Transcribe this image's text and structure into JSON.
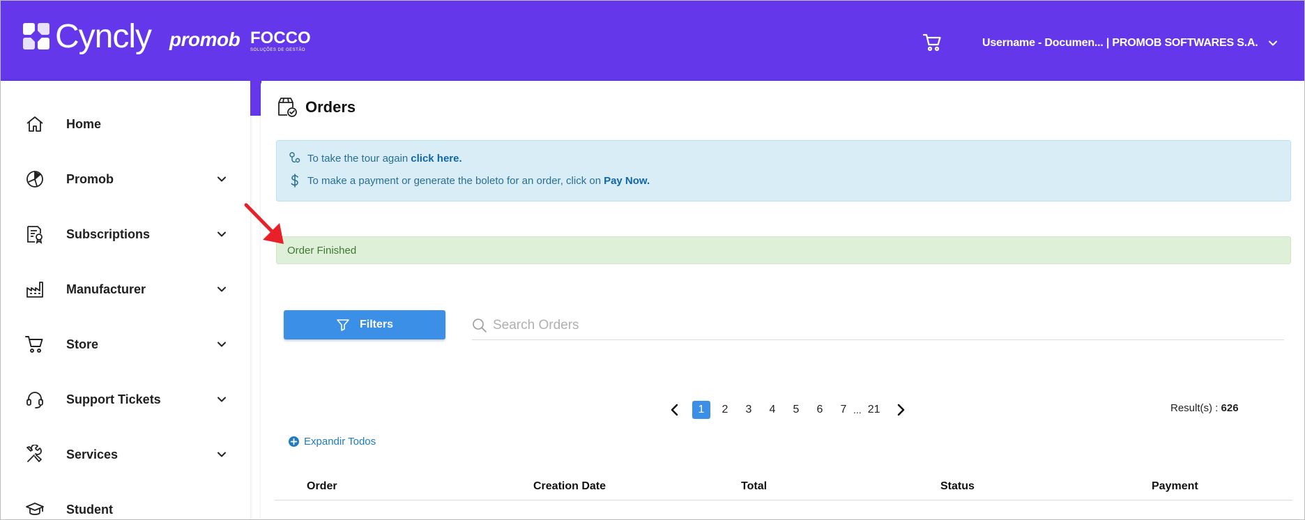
{
  "header": {
    "logo_cyncly": "Cyncly",
    "logo_promob": "promob",
    "logo_focco": "FOCCO",
    "logo_focco_tagline": "SOLUÇÕES DE GESTÃO",
    "user_label": "Username - Documen... | PROMOB SOFTWARES S.A.",
    "icons": {
      "cart": "cart-icon",
      "user_dropdown": "chevron-down-icon"
    }
  },
  "sidebar": {
    "items": [
      {
        "label": "Home",
        "icon": "home-icon",
        "has_submenu": false
      },
      {
        "label": "Promob",
        "icon": "promob-icon",
        "has_submenu": true
      },
      {
        "label": "Subscriptions",
        "icon": "subscriptions-icon",
        "has_submenu": true
      },
      {
        "label": "Manufacturer",
        "icon": "factory-icon",
        "has_submenu": true
      },
      {
        "label": "Store",
        "icon": "cart-icon",
        "has_submenu": true
      },
      {
        "label": "Support Tickets",
        "icon": "headset-icon",
        "has_submenu": true
      },
      {
        "label": "Services",
        "icon": "tools-icon",
        "has_submenu": true
      },
      {
        "label": "Student",
        "icon": "graduation-cap-icon",
        "has_submenu": false
      }
    ]
  },
  "main": {
    "title": "Orders",
    "info": {
      "tour_text": "To take the tour again",
      "tour_link": "click here.",
      "payment_text": "To make a payment or generate the boleto for an order, click on",
      "payment_link": "Pay Now."
    },
    "alert": "Order Finished",
    "filters_label": "Filters",
    "search_placeholder": "Search Orders",
    "pagination": {
      "pages": [
        "1",
        "2",
        "3",
        "4",
        "5",
        "6",
        "7"
      ],
      "ellipsis": "...",
      "last_page": "21",
      "current": "1"
    },
    "results_label": "Result(s) :",
    "results_count": "626",
    "expand_all": "Expandir Todos",
    "table_columns": [
      "Order",
      "Creation Date",
      "Total",
      "Status",
      "Payment"
    ]
  },
  "colors": {
    "brand_purple": "#6438ea",
    "primary_blue": "#3c8fe6",
    "info_bg": "#d9edf7",
    "success_bg": "#dff0d8",
    "annotation_red": "#e8202a"
  }
}
